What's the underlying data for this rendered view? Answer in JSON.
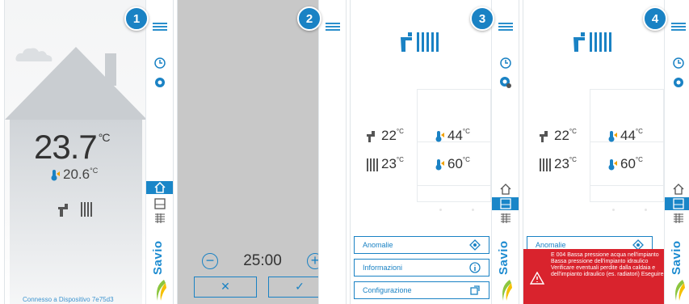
{
  "colors": {
    "accent": "#1a82c4",
    "alarm": "#d9232d"
  },
  "panels": [
    {
      "badge": "1",
      "temp_main": "23.7",
      "temp_main_unit": "°C",
      "temp_room": "20.6",
      "temp_room_unit": "°C",
      "connection": "Connesso a Dispositivo 7e75d3"
    },
    {
      "badge": "2",
      "timer": "25:00",
      "minus": "−",
      "plus": "+",
      "cancel": "✕",
      "confirm": "✓"
    },
    {
      "badge": "3",
      "tap_temp": "22",
      "heat_temp": "23",
      "tap_set": "44",
      "heat_set": "60",
      "unit": "°C",
      "menu": [
        {
          "label": "Anomalie"
        },
        {
          "label": "Informazioni"
        },
        {
          "label": "Configurazione"
        }
      ]
    },
    {
      "badge": "4",
      "tap_temp": "22",
      "heat_temp": "23",
      "tap_set": "44",
      "heat_set": "60",
      "unit": "°C",
      "anomaly_label": "Anomalie",
      "alarm_text": "E 004 Bassa pressione acqua nell'impianto Bassa pressione dell'impianto idraulico Verificare eventuali perdite dalla caldaia e dell'impianto idraulico (es. radiatori) Eseguire"
    }
  ],
  "brand": "Savio",
  "icons": [
    "menu-icon",
    "clock-icon",
    "badge-icon",
    "home-icon",
    "save-icon",
    "radiator-settings-icon",
    "thermometer-icon",
    "tap-icon",
    "radiator-icon",
    "warning-icon",
    "info-icon",
    "config-icon",
    "diamond-icon"
  ]
}
